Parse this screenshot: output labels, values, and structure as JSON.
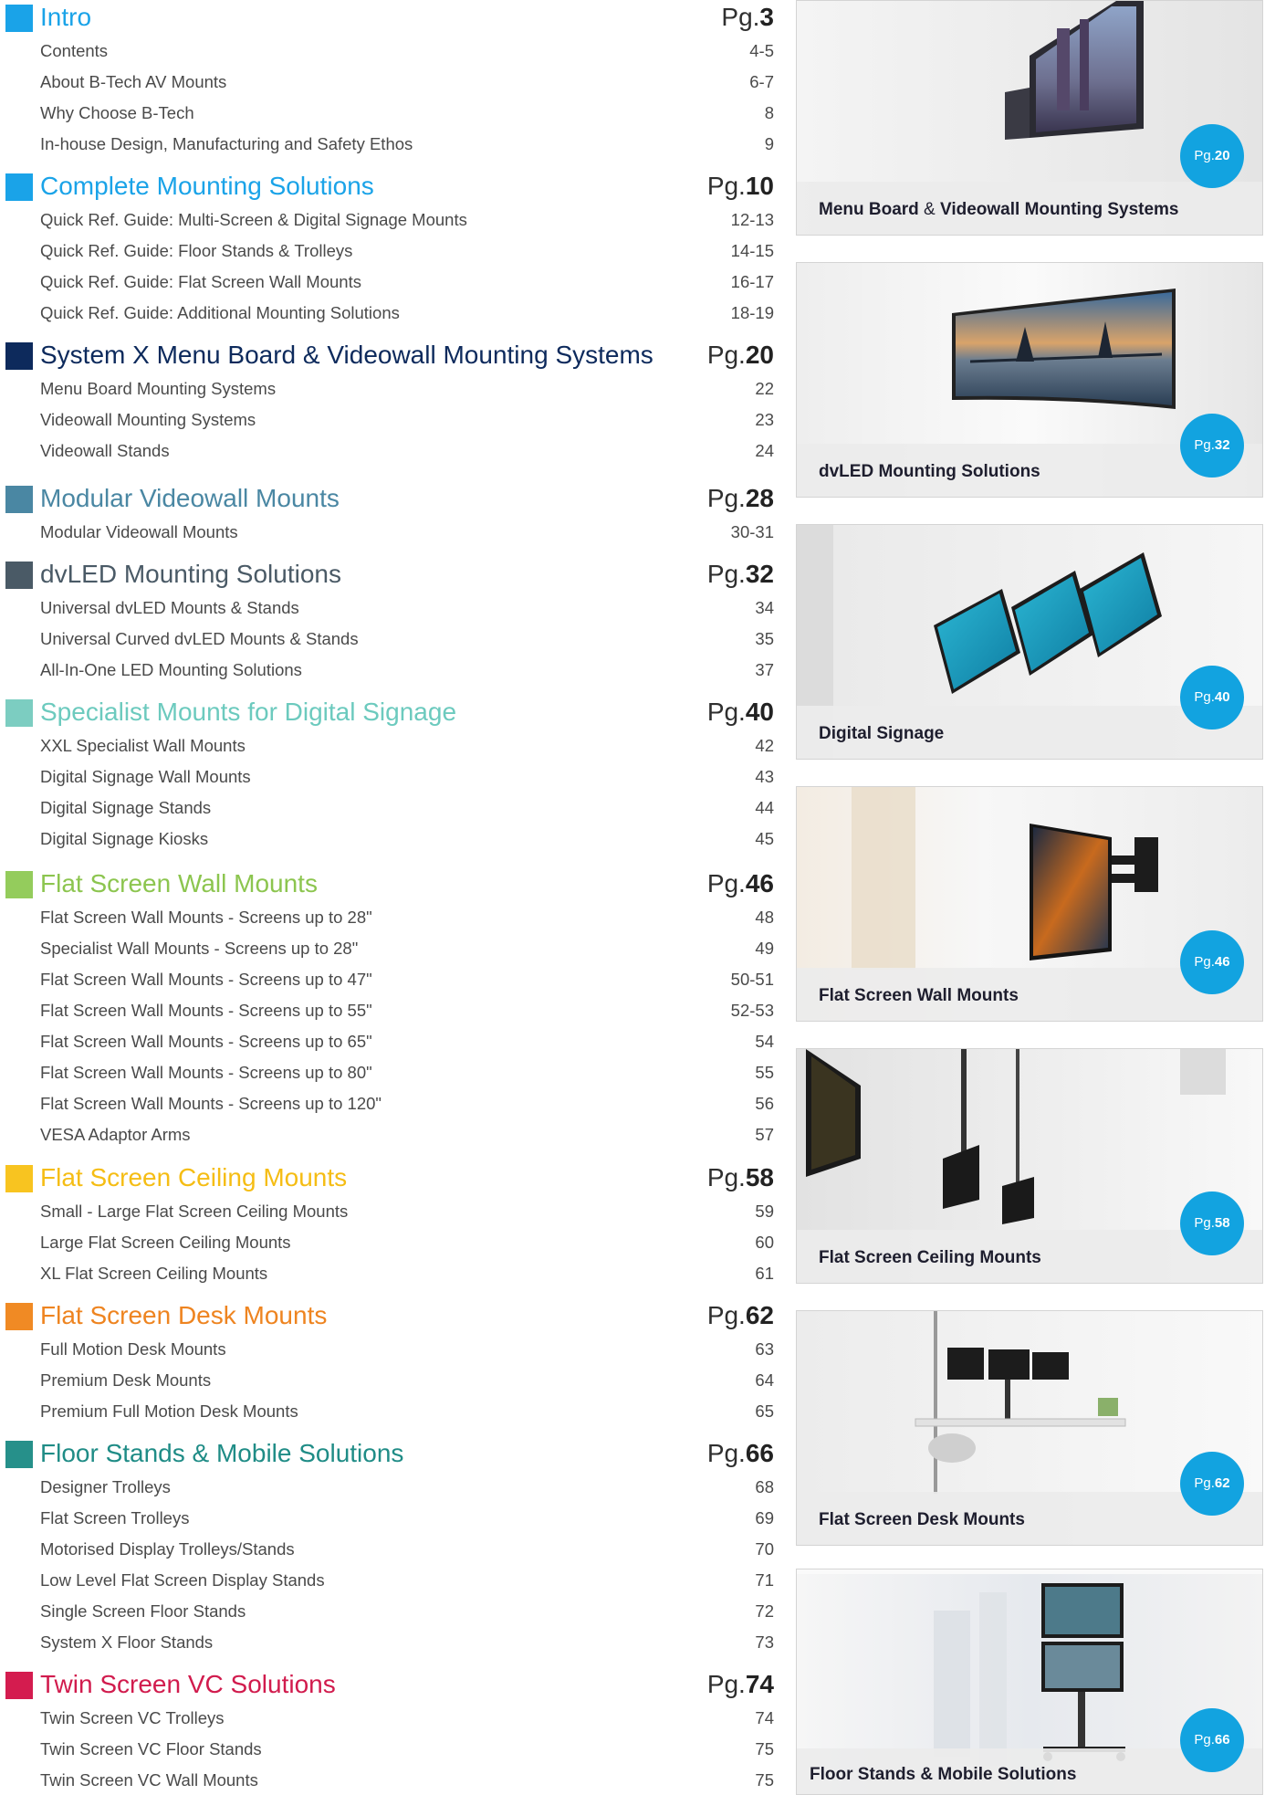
{
  "toc": [
    {
      "title": "Intro",
      "color": "#1aa3e8",
      "title_color": "#1aa3e8",
      "page_prefix": "Pg.",
      "page": "3",
      "items": [
        {
          "label": "Contents",
          "page": "4-5"
        },
        {
          "label": "About B-Tech AV Mounts",
          "page": "6-7"
        },
        {
          "label": "Why Choose B-Tech",
          "page": "8"
        },
        {
          "label": "In-house Design, Manufacturing and Safety Ethos",
          "page": "9"
        }
      ]
    },
    {
      "title": "Complete Mounting Solutions",
      "color": "#1aa3e8",
      "title_color": "#1aa3e8",
      "page_prefix": "Pg.",
      "page": "10",
      "items": [
        {
          "label": "Quick Ref. Guide: Multi-Screen & Digital Signage Mounts",
          "page": "12-13"
        },
        {
          "label": "Quick Ref. Guide: Floor Stands & Trolleys",
          "page": "14-15"
        },
        {
          "label": "Quick Ref. Guide: Flat Screen Wall Mounts",
          "page": "16-17"
        },
        {
          "label": "Quick Ref. Guide: Additional Mounting Solutions",
          "page": "18-19"
        }
      ]
    },
    {
      "title": "System X Menu Board & Videowall Mounting Systems",
      "color": "#0d2a5c",
      "title_color": "#0d2a5c",
      "page_prefix": "Pg.",
      "page": "20",
      "items": [
        {
          "label": "Menu Board Mounting Systems",
          "page": "22"
        },
        {
          "label": "Videowall Mounting Systems",
          "page": "23"
        },
        {
          "label": "Videowall Stands",
          "page": "24"
        }
      ]
    },
    {
      "title": "Modular Videowall Mounts",
      "color": "#4a87a3",
      "title_color": "#4a87a3",
      "page_prefix": "Pg.",
      "page": "28",
      "items": [
        {
          "label": "Modular Videowall Mounts",
          "page": "30-31"
        }
      ]
    },
    {
      "title": "dvLED Mounting Solutions",
      "color": "#4a5a66",
      "title_color": "#4a5a66",
      "page_prefix": "Pg.",
      "page": "32",
      "items": [
        {
          "label": "Universal dvLED Mounts & Stands",
          "page": "34"
        },
        {
          "label": "Universal Curved dvLED Mounts & Stands",
          "page": "35"
        },
        {
          "label": "All-In-One LED Mounting Solutions",
          "page": "37"
        }
      ]
    },
    {
      "title": "Specialist Mounts for Digital Signage",
      "color": "#7ccdc1",
      "title_color": "#6ccabe",
      "page_prefix": "Pg.",
      "page": "40",
      "items": [
        {
          "label": "XXL Specialist Wall Mounts",
          "page": "42"
        },
        {
          "label": "Digital Signage Wall Mounts",
          "page": "43"
        },
        {
          "label": "Digital Signage Stands",
          "page": "44"
        },
        {
          "label": "Digital Signage Kiosks",
          "page": "45"
        }
      ]
    },
    {
      "title": "Flat Screen Wall Mounts",
      "color": "#94cc5c",
      "title_color": "#8cc54f",
      "page_prefix": "Pg.",
      "page": "46",
      "items": [
        {
          "label": "Flat Screen Wall Mounts - Screens up to 28\"",
          "page": "48"
        },
        {
          "label": "Specialist Wall Mounts - Screens up to 28\"",
          "page": "49"
        },
        {
          "label": "Flat Screen Wall Mounts - Screens up to 47\"",
          "page": "50-51"
        },
        {
          "label": "Flat Screen Wall Mounts - Screens up to 55\"",
          "page": "52-53"
        },
        {
          "label": "Flat Screen Wall Mounts - Screens up to 65\"",
          "page": "54"
        },
        {
          "label": "Flat Screen Wall Mounts - Screens up to 80\"",
          "page": "55"
        },
        {
          "label": "Flat Screen Wall Mounts - Screens up to 120\"",
          "page": "56"
        },
        {
          "label": "VESA Adaptor Arms",
          "page": "57"
        }
      ]
    },
    {
      "title": "Flat Screen Ceiling Mounts",
      "color": "#f8c420",
      "title_color": "#f5bd14",
      "page_prefix": "Pg.",
      "page": "58",
      "items": [
        {
          "label": "Small - Large Flat Screen Ceiling Mounts",
          "page": "59"
        },
        {
          "label": "Large Flat Screen Ceiling Mounts",
          "page": "60"
        },
        {
          "label": "XL Flat Screen Ceiling Mounts",
          "page": "61"
        }
      ]
    },
    {
      "title": "Flat Screen Desk Mounts",
      "color": "#f08a24",
      "title_color": "#ee8420",
      "page_prefix": "Pg.",
      "page": "62",
      "items": [
        {
          "label": "Full Motion Desk Mounts",
          "page": "63"
        },
        {
          "label": "Premium Desk Mounts",
          "page": "64"
        },
        {
          "label": "Premium Full Motion Desk Mounts",
          "page": "65"
        }
      ]
    },
    {
      "title": "Floor Stands & Mobile Solutions",
      "color": "#26908a",
      "title_color": "#1f8c86",
      "page_prefix": "Pg.",
      "page": "66",
      "items": [
        {
          "label": "Designer Trolleys",
          "page": "68"
        },
        {
          "label": "Flat Screen Trolleys",
          "page": "69"
        },
        {
          "label": "Motorised Display Trolleys/Stands",
          "page": "70"
        },
        {
          "label": "Low Level Flat Screen Display Stands",
          "page": "71"
        },
        {
          "label": "Single Screen Floor Stands",
          "page": "72"
        },
        {
          "label": "System X Floor Stands",
          "page": "73"
        }
      ]
    },
    {
      "title": "Twin Screen VC Solutions",
      "color": "#d41c4f",
      "title_color": "#d11b4d",
      "page_prefix": "Pg.",
      "page": "74",
      "items": [
        {
          "label": "Twin Screen VC Trolleys",
          "page": "74"
        },
        {
          "label": "Twin Screen VC  Floor Stands",
          "page": "75"
        },
        {
          "label": "Twin Screen VC  Wall Mounts",
          "page": "75"
        }
      ]
    }
  ],
  "cards": [
    {
      "caption_a": "Menu Board",
      "caption_amp": " & ",
      "caption_b": "Videowall Mounting Systems",
      "badge_prefix": "Pg.",
      "badge_page": "20",
      "icon": "videowall-photo"
    },
    {
      "caption_a": "dvLED Mounting Solutions",
      "caption_amp": "",
      "caption_b": "",
      "badge_prefix": "Pg.",
      "badge_page": "32",
      "icon": "curved-dvled-photo"
    },
    {
      "caption_a": "Digital Signage",
      "caption_amp": "",
      "caption_b": "",
      "badge_prefix": "Pg.",
      "badge_page": "40",
      "icon": "digital-signage-photo"
    },
    {
      "caption_a": "Flat Screen Wall Mounts",
      "caption_amp": "",
      "caption_b": "",
      "badge_prefix": "Pg.",
      "badge_page": "46",
      "icon": "wall-mount-photo"
    },
    {
      "caption_a": "Flat Screen Ceiling Mounts",
      "caption_amp": "",
      "caption_b": "",
      "badge_prefix": "Pg.",
      "badge_page": "58",
      "icon": "ceiling-mount-photo"
    },
    {
      "caption_a": "Flat Screen Desk Mounts",
      "caption_amp": "",
      "caption_b": "",
      "badge_prefix": "Pg.",
      "badge_page": "62",
      "icon": "desk-mount-photo"
    },
    {
      "caption_a": "Floor Stands & Mobile Solutions",
      "caption_amp": "",
      "caption_b": "",
      "badge_prefix": "Pg.",
      "badge_page": "66",
      "icon": "floor-stand-photo"
    }
  ]
}
